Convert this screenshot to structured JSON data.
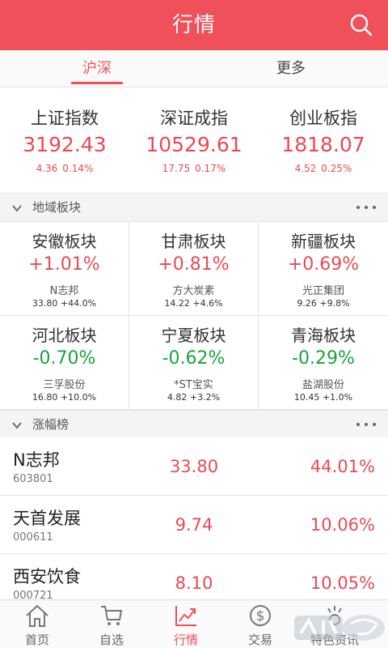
{
  "header": {
    "title": "行情"
  },
  "tabs": [
    {
      "label": "沪深"
    },
    {
      "label": "更多"
    }
  ],
  "indices": [
    {
      "name": "上证指数",
      "value": "3192.43",
      "change": "4.36",
      "percent": "0.14%"
    },
    {
      "name": "深证成指",
      "value": "10529.61",
      "change": "17.75",
      "percent": "0.17%"
    },
    {
      "name": "创业板指",
      "value": "1818.07",
      "change": "4.52",
      "percent": "0.25%"
    }
  ],
  "region_section": {
    "label": "地域板块",
    "cells": [
      {
        "name": "安徽板块",
        "pct": "+1.01%",
        "stock": "N志邦",
        "price": "33.80",
        "stock_pct": "+44.0%"
      },
      {
        "name": "甘肃板块",
        "pct": "+0.81%",
        "stock": "方大炭素",
        "price": "14.22",
        "stock_pct": "+4.6%"
      },
      {
        "name": "新疆板块",
        "pct": "+0.69%",
        "stock": "光正集团",
        "price": "9.26",
        "stock_pct": "+9.8%"
      },
      {
        "name": "河北板块",
        "pct": "-0.70%",
        "stock": "三孚股份",
        "price": "16.80",
        "stock_pct": "+10.0%"
      },
      {
        "name": "宁夏板块",
        "pct": "-0.62%",
        "stock": "*ST宝实",
        "price": "4.82",
        "stock_pct": "+3.2%"
      },
      {
        "name": "青海板块",
        "pct": "-0.29%",
        "stock": "盐湖股份",
        "price": "10.45",
        "stock_pct": "+1.0%"
      }
    ]
  },
  "gainers_section": {
    "label": "涨幅榜",
    "rows": [
      {
        "name": "N志邦",
        "code": "603801",
        "price": "33.80",
        "pct": "44.01%"
      },
      {
        "name": "天首发展",
        "code": "000611",
        "price": "9.74",
        "pct": "10.06%"
      },
      {
        "name": "西安饮食",
        "code": "000721",
        "price": "8.10",
        "pct": "10.05%"
      }
    ]
  },
  "bottom_nav": [
    {
      "label": "首页",
      "icon": "home-icon"
    },
    {
      "label": "自选",
      "icon": "cart-icon"
    },
    {
      "label": "行情",
      "icon": "chart-trend-icon"
    },
    {
      "label": "交易",
      "icon": "dollar-coin-icon"
    },
    {
      "label": "特色资讯",
      "icon": "news-icon"
    }
  ],
  "colors": {
    "brand": "#f0505a",
    "up": "#e84a55",
    "down": "#1aa33a"
  }
}
